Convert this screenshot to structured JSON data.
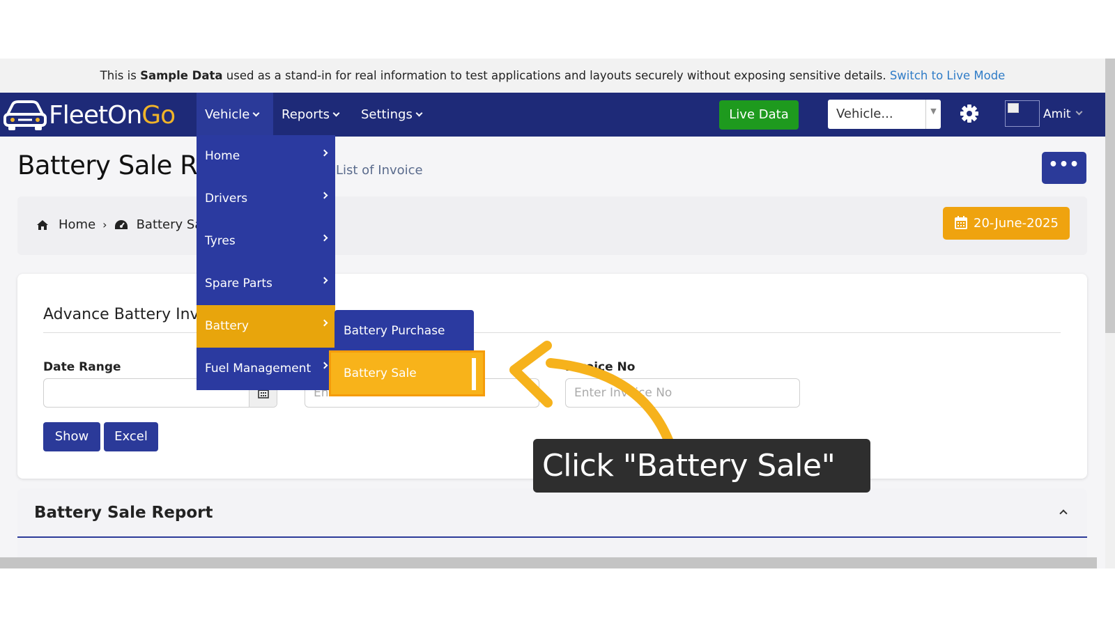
{
  "notice": {
    "prefix": "This is ",
    "bold": "Sample Data",
    "suffix": " used as a stand-in for real information to test applications and layouts securely without exposing sensitive details. ",
    "link": "Switch to Live Mode"
  },
  "navbar": {
    "logo_part1": "FleetOn",
    "logo_part2": "Go",
    "menu": [
      "Vehicle",
      "Reports",
      "Settings"
    ],
    "live_data": "Live Data",
    "vehicle_select": "Vehicle...",
    "user": "Amit"
  },
  "page": {
    "title": "Battery Sale Re",
    "subtitle": "List of Invoice",
    "more": "•••"
  },
  "breadcrumb": {
    "home": "Home",
    "current": "Battery Sa"
  },
  "date_button": "20-June-2025",
  "filter": {
    "title": "Advance Battery Inv",
    "date_range_label": "Date Range",
    "date_range_value": "",
    "sale_to_placeholder": "Enter Sale to",
    "invoice_label": "Invoice No",
    "invoice_placeholder": "Enter Invoice No",
    "show": "Show",
    "excel": "Excel"
  },
  "report": {
    "title": "Battery Sale Report"
  },
  "vehicle_menu": {
    "items": [
      "Home",
      "Drivers",
      "Tyres",
      "Spare Parts",
      "Battery",
      "Fuel Management"
    ],
    "highlighted": "Battery"
  },
  "battery_submenu": {
    "items": [
      "Battery Purchase",
      "Battery Sale"
    ]
  },
  "tooltip": "Click \"Battery Sale\"",
  "colors": {
    "navbar": "#1e2a78",
    "menu": "#2b3aa0",
    "accent": "#e8a50c",
    "live_button": "#1e9a1e",
    "annotation_arrow": "#f6b21c"
  }
}
